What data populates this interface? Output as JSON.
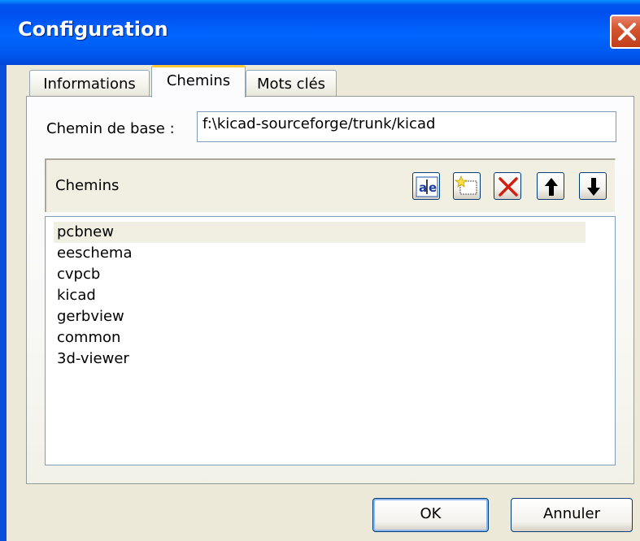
{
  "window": {
    "title": "Configuration"
  },
  "tabs": [
    {
      "label": "Informations",
      "active": false
    },
    {
      "label": "Chemins",
      "active": true
    },
    {
      "label": "Mots clés",
      "active": false
    }
  ],
  "base_path": {
    "label": "Chemin de base :",
    "value": "f:\\kicad-sourceforge/trunk/kicad"
  },
  "paths": {
    "header_label": "Chemins",
    "toolbar": [
      {
        "name": "edit-icon",
        "tooltip": ""
      },
      {
        "name": "new-item-icon",
        "tooltip": ""
      },
      {
        "name": "delete-icon",
        "tooltip": ""
      },
      {
        "name": "arrow-up-icon",
        "tooltip": ""
      },
      {
        "name": "arrow-down-icon",
        "tooltip": ""
      }
    ],
    "items": [
      "pcbnew",
      "eeschema",
      "cvpcb",
      "kicad",
      "gerbview",
      "common",
      "3d-viewer"
    ],
    "selected_index": 0
  },
  "buttons": {
    "ok": "OK",
    "cancel": "Annuler"
  },
  "colors": {
    "titlebar": "#0058EE",
    "close": "#D4552F",
    "tab_active_highlight": "#FFC83C",
    "dialog_bg": "#ECE9D8"
  }
}
